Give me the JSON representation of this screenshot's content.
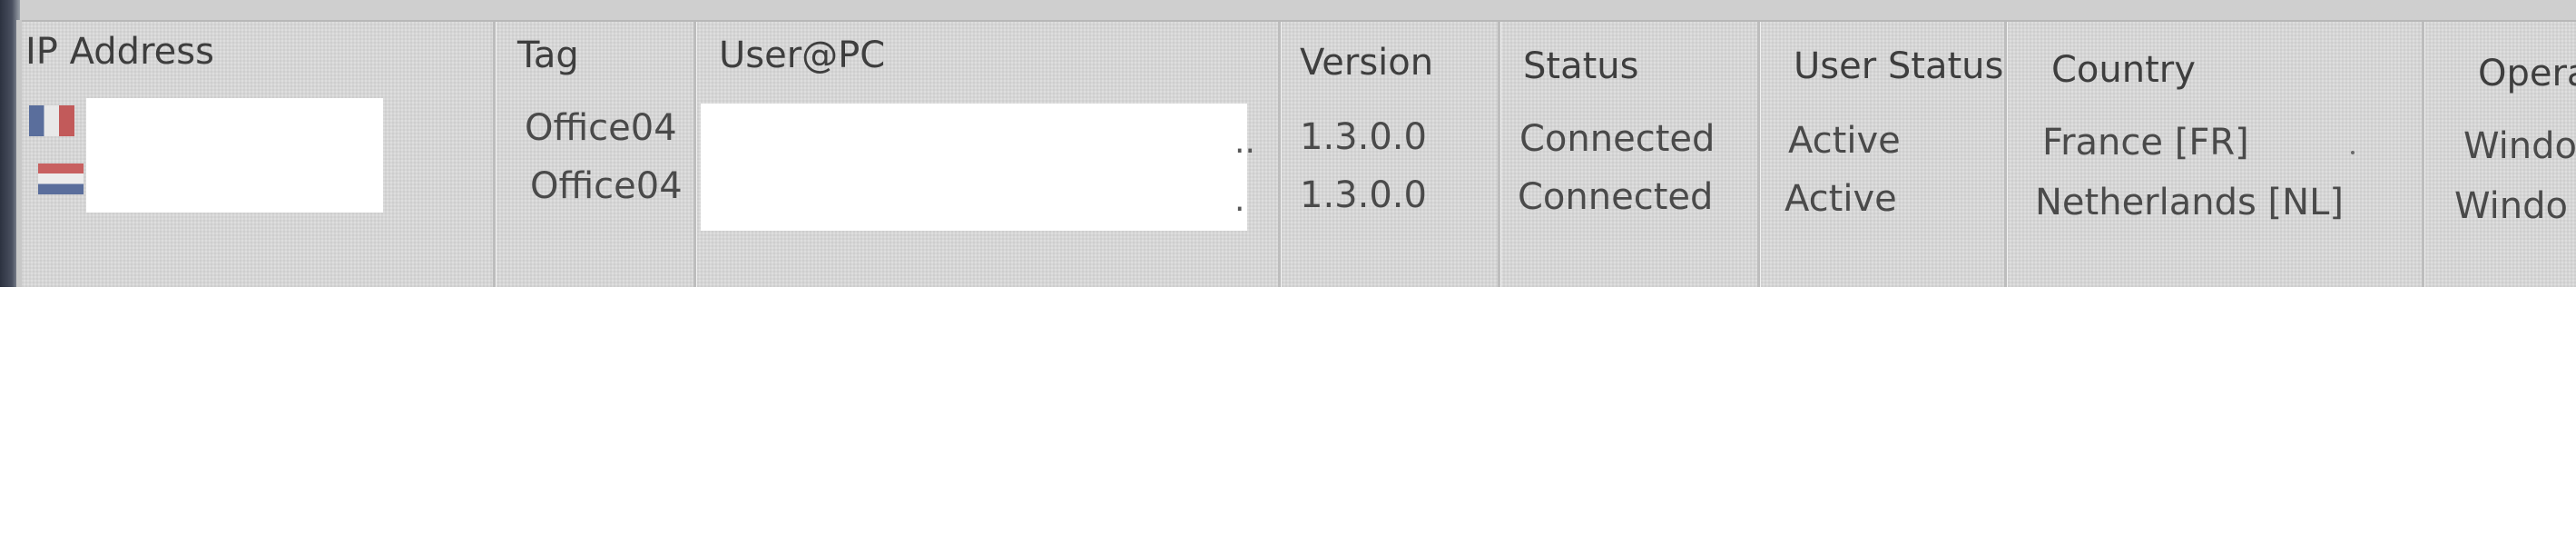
{
  "columns": {
    "ip_address": "IP Address",
    "tag": "Tag",
    "user_pc": "User@PC",
    "version": "Version",
    "status": "Status",
    "user_status": "User Status",
    "country": "Country",
    "operating_system": "Opera"
  },
  "rows": [
    {
      "flag_icon": "france-flag-icon",
      "tag": "Office04",
      "user_pc_suffix": "..",
      "version": "1.3.0.0",
      "status": "Connected",
      "user_status": "Active",
      "country": "France [FR]",
      "operating_system": "Windo"
    },
    {
      "flag_icon": "netherlands-flag-icon",
      "tag": "Office04",
      "user_pc_suffix": ".",
      "version": "1.3.0.0",
      "status": "Connected",
      "user_status": "Active",
      "country": "Netherlands [NL]",
      "operating_system": "Windo"
    }
  ],
  "colors": {
    "background": "#dcdcdc",
    "text": "#4a4a4a",
    "header_text": "#3e3e3e",
    "redaction": "#ffffff"
  }
}
